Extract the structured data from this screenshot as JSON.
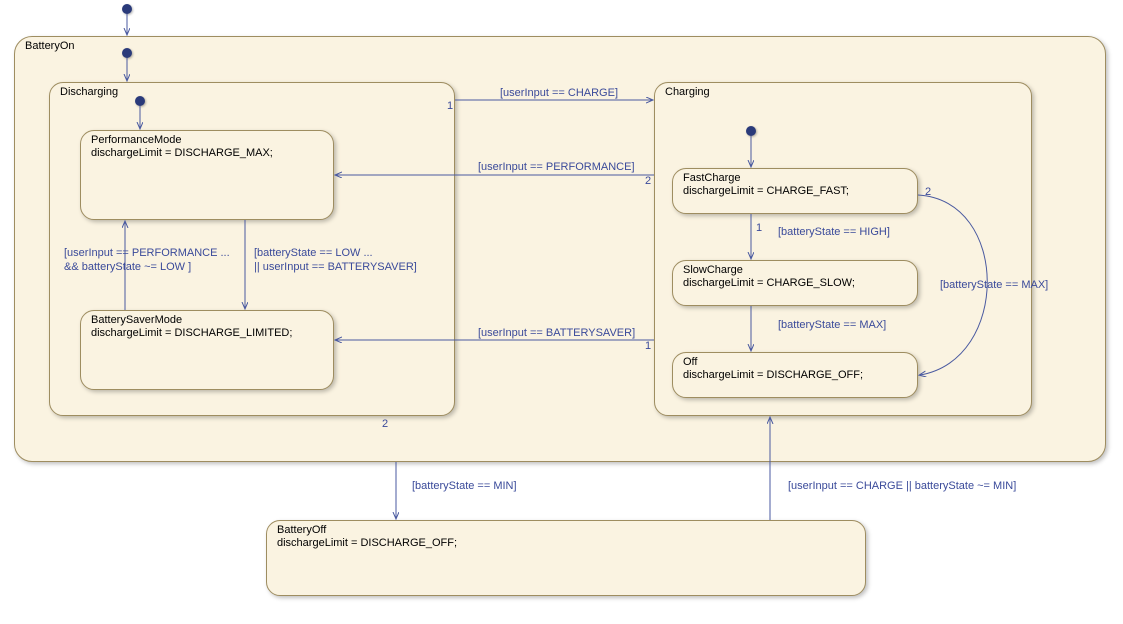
{
  "states": {
    "batteryOn": {
      "name": "BatteryOn"
    },
    "discharging": {
      "name": "Discharging"
    },
    "performanceMode": {
      "name": "PerformanceMode",
      "body": "dischargeLimit = DISCHARGE_MAX;"
    },
    "batterySaverMode": {
      "name": "BatterySaverMode",
      "body": "dischargeLimit = DISCHARGE_LIMITED;"
    },
    "charging": {
      "name": "Charging"
    },
    "fastCharge": {
      "name": "FastCharge",
      "body": "dischargeLimit = CHARGE_FAST;"
    },
    "slowCharge": {
      "name": "SlowCharge",
      "body": "dischargeLimit = CHARGE_SLOW;"
    },
    "off": {
      "name": "Off",
      "body": "dischargeLimit = DISCHARGE_OFF;"
    },
    "batteryOff": {
      "name": "BatteryOff",
      "body": "dischargeLimit = DISCHARGE_OFF;"
    }
  },
  "transitions": {
    "toCharge": "[userInput == CHARGE]",
    "toPerformance": "[userInput == PERFORMANCE]",
    "toBatterySaver": "[userInput == BATTERYSAVER]",
    "perfToSaverLine1": "[batteryState == LOW ...",
    "perfToSaverLine2": "|| userInput == BATTERYSAVER]",
    "saverToPerfLine1": "[userInput == PERFORMANCE ...",
    "saverToPerfLine2": "&& batteryState  ~= LOW  ]",
    "fastToSlow": "[batteryState == HIGH]",
    "slowToOff": "[batteryState == MAX]",
    "fastToOff": "[batteryState == MAX]",
    "onToOff": "[batteryState == MIN]",
    "offToOn": "[userInput == CHARGE || batteryState ~= MIN]"
  },
  "nums": {
    "n1": "1",
    "n2": "2"
  }
}
